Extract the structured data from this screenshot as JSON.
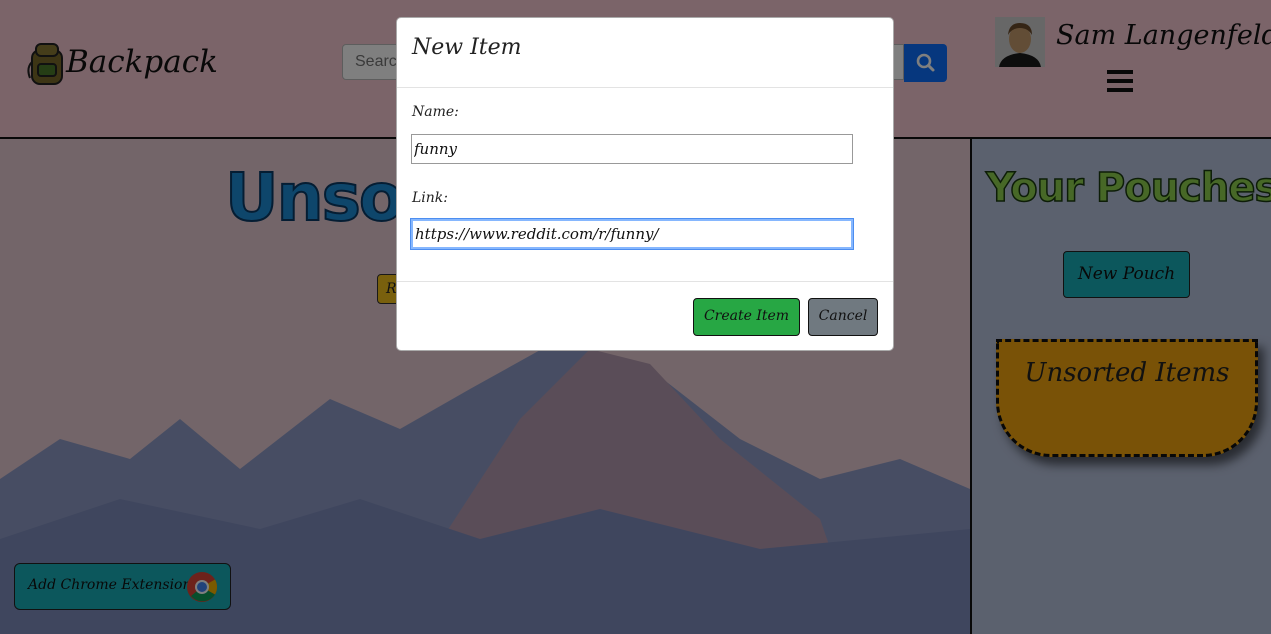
{
  "header": {
    "logo_text": "Backpack",
    "search": {
      "placeholder": "Search",
      "value": ""
    },
    "user_name": "Sam Langenfeld"
  },
  "main": {
    "title": "Unsorted Items",
    "sort_button_label": "R",
    "chrome_extension_label": "Add Chrome Extension"
  },
  "sidebar": {
    "title": "Your Pouches",
    "new_pouch_label": "New Pouch",
    "pouches": [
      {
        "title": "Unsorted Items"
      }
    ]
  },
  "modal": {
    "title": "New Item",
    "name_label": "Name:",
    "name_value": "funny",
    "link_label": "Link:",
    "link_value": "https://www.reddit.com/r/funny/",
    "create_label": "Create Item",
    "cancel_label": "Cancel"
  },
  "colors": {
    "header_bg": "#f6c8d2",
    "search_button": "#0d6efd",
    "create_button": "#27a744",
    "cancel_button": "#707980",
    "teal_button": "#19aeb8",
    "pouch_card": "#f3a50f",
    "title_blue": "#1d8cd6",
    "sidebar_title": "#8fd14f"
  },
  "icons": [
    "backpack-logo-icon",
    "search-icon",
    "user-avatar",
    "hamburger-menu-icon",
    "chrome-icon"
  ]
}
